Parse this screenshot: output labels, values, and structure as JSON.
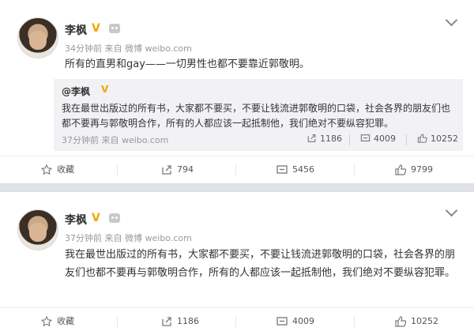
{
  "post1": {
    "author": "李枫",
    "meta": "34分钟前 来自 微博 weibo.com",
    "text": "所有的直男和gay——一切男性也都不要靠近郭敬明。",
    "repost": {
      "author": "@李枫",
      "text": "我在最世出版过的所有书，大家都不要买，不要让钱流进郭敬明的口袋，社会各界的朋友们也都不要再与郭敬明合作，所有的人都应该一起抵制他，我们绝对不要纵容犯罪。",
      "meta": "37分钟前 来自 weibo.com",
      "reposts": "1186",
      "comments": "4009",
      "likes": "10252"
    },
    "actions": {
      "favorite": "收藏",
      "reposts": "794",
      "comments": "5456",
      "likes": "9799"
    }
  },
  "post2": {
    "author": "李枫",
    "meta": "37分钟前 来自 微博 weibo.com",
    "text": "我在最世出版过的所有书，大家都不要买，不要让钱流进郭敬明的口袋，社会各界的朋友们也都不要再与郭敬明合作，所有的人都应该一起抵制他，我们绝对不要纵容犯罪。",
    "actions": {
      "favorite": "收藏",
      "reposts": "1186",
      "comments": "4009",
      "likes": "10252"
    }
  },
  "icons": [
    "verified-v-icon",
    "robot-icon",
    "chevron-down-icon",
    "star-icon",
    "share-icon",
    "comment-icon",
    "thumbs-up-icon"
  ],
  "colors": {
    "verified": "#f2a400",
    "meta": "#999999",
    "background": "#dfe3e8"
  }
}
